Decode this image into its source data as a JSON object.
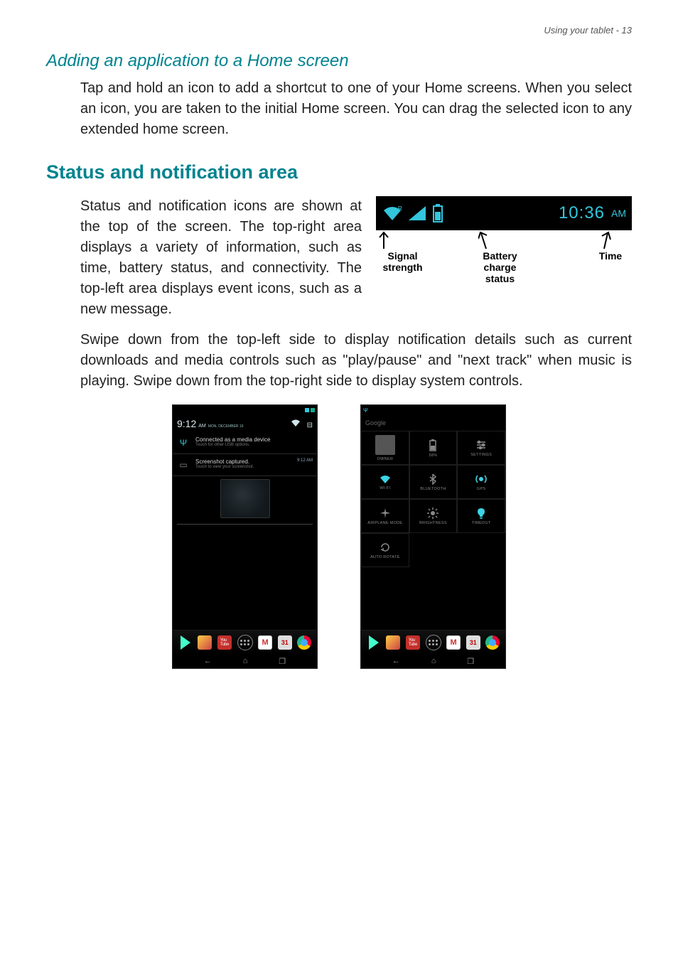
{
  "header": {
    "line": "Using your tablet - 13"
  },
  "section1": {
    "heading": "Adding an application to a Home screen",
    "body": "Tap and hold an icon to add a shortcut to one of your Home screens. When you select an icon, you are taken to the initial Home screen. You can drag the selected icon to any extended home screen."
  },
  "section2": {
    "heading": "Status and notification area",
    "body1": "Status and notification icons are shown at the top of the screen. The top-right area displays a variety of information, such as time, battery status, and connectivity. The top-left area displays event icons, such as a new message.",
    "body2": "Swipe down from the top-left side to display notification details such as current downloads and media controls such as \"play/pause\" and \"next track\" when music is playing. Swipe down from the top-right side to display system controls."
  },
  "statusbar": {
    "time": "10:36",
    "am": "AM",
    "ann": {
      "signal": "Signal strength",
      "battery": "Battery charge status",
      "time": "Time"
    }
  },
  "phoneLeft": {
    "time": "9:12",
    "am": "AM",
    "date": "MON, DECEMBER 16",
    "nots": [
      {
        "title": "Connected as a media device",
        "sub": "Touch for other USB options."
      },
      {
        "title": "Screenshot captured.",
        "sub": "Touch to view your screenshot.",
        "time": "9:12 AM"
      }
    ],
    "cal": "31"
  },
  "phoneRight": {
    "google": "Google",
    "tiles": [
      {
        "label": "OWNER",
        "on": false,
        "icon": "avatar"
      },
      {
        "label": "58%",
        "on": false,
        "icon": "battery"
      },
      {
        "label": "SETTINGS",
        "on": false,
        "icon": "sliders"
      },
      {
        "label": "WI-FI",
        "on": true,
        "icon": "wifi"
      },
      {
        "label": "BLUETOOTH",
        "on": false,
        "icon": "bt"
      },
      {
        "label": "GPS",
        "on": true,
        "icon": "gps"
      },
      {
        "label": "AIRPLANE MODE",
        "on": false,
        "icon": "plane"
      },
      {
        "label": "BRIGHTNESS",
        "on": false,
        "icon": "sun"
      },
      {
        "label": "TIMEOUT",
        "on": true,
        "icon": "bulb"
      },
      {
        "label": "AUTO ROTATE",
        "on": false,
        "icon": "rotate"
      }
    ],
    "cal": "31"
  }
}
